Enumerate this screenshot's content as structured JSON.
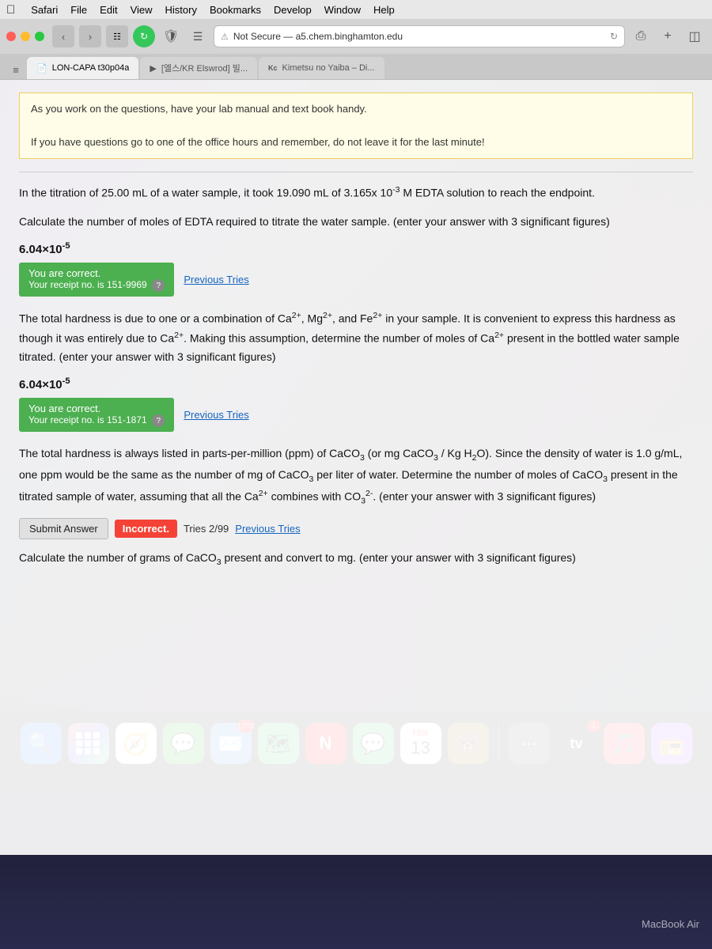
{
  "menubar": {
    "apple": "🍎",
    "items": [
      "Safari",
      "File",
      "Edit",
      "View",
      "History",
      "Bookmarks",
      "Develop",
      "Window",
      "Help"
    ]
  },
  "browser": {
    "url": "Not Secure — a5.chem.binghamton.edu",
    "url_full": "a5.chem.binghamton.edu",
    "tabs": [
      {
        "label": "LON-CAPA t30p04a",
        "icon": "📄",
        "active": true
      },
      {
        "label": "[엘스/KR Elswrod] 빌...",
        "icon": "▶",
        "active": false
      },
      {
        "label": "Kimetsu no Yaiba – Di...",
        "icon": "Kc",
        "active": false
      }
    ]
  },
  "notice": {
    "line1": "As you work on the questions, have your lab manual and text book handy.",
    "line2": "If you have questions go to one of the office hours and remember, do not leave it for the last minute!"
  },
  "question1": {
    "text": "In the titration of 25.00 mL of a water sample, it took 19.090 mL of 3.165x 10⁻³ M EDTA solution to reach the endpoint.",
    "subtext": "Calculate the number of moles of EDTA required to titrate the water sample. (enter your answer with 3 significant figures)",
    "answer": "6.04×10⁻⁵",
    "status": "You are correct.",
    "receipt": "Your receipt no. is 151-9969",
    "prev_tries": "Previous Tries"
  },
  "question2": {
    "text": "The total hardness is due to one or a combination of Ca²⁺, Mg²⁺, and Fe²⁺ in your sample. It is convenient to express this hardness as though it was entirely due to Ca²⁺. Making this assumption, determine the number of moles of Ca²⁺ present in the bottled water sample titrated. (enter your answer with 3 significant figures)",
    "answer": "6.04×10⁻⁵",
    "status": "You are correct.",
    "receipt": "Your receipt no. is 151-1871",
    "prev_tries": "Previous Tries"
  },
  "question3": {
    "text1": "The total hardness is always listed in parts-per-million (ppm) of CaCO₃ (or mg CaCO₃ / Kg H₂O). Since the density of water is 1.0 g/mL, one ppm would be the same as the number of mg of CaCO₃ per liter of water. Determine the number of moles of CaCO₃ present in the titrated sample of water, assuming that all the Ca²⁺ combines with CO₃²⁻. (enter your answer with 3 significant figures)",
    "submit_label": "Submit Answer",
    "status": "Incorrect.",
    "tries": "Tries 2/99",
    "prev_tries": "Previous Tries"
  },
  "question4": {
    "text": "Calculate the number of grams of CaCO₃ present and convert to mg. (enter your answer with 3 significant figures)"
  },
  "dock": {
    "icons": [
      {
        "emoji": "🔍",
        "label": "Finder",
        "bg": "#1a73e8"
      },
      {
        "emoji": "⠿",
        "label": "Launchpad",
        "bg": "#e0e0e0"
      },
      {
        "emoji": "🧭",
        "label": "Safari",
        "bg": "#34c759"
      },
      {
        "emoji": "💬",
        "label": "WeChat",
        "bg": "#2db526"
      },
      {
        "emoji": "📧",
        "label": "Mail",
        "bg": "#e8f0fe",
        "badge": "1772"
      },
      {
        "emoji": "🗺",
        "label": "Maps",
        "bg": "#34c759"
      },
      {
        "emoji": "N",
        "label": "News",
        "bg": "#f00"
      },
      {
        "emoji": "📱",
        "label": "Messages",
        "bg": "#34c759"
      },
      {
        "feb": true,
        "month": "FEB",
        "day": "13",
        "label": "Calendar"
      },
      {
        "emoji": "🟤",
        "label": "Bear",
        "bg": "#b5651d"
      },
      {
        "emoji": "⠿",
        "label": "App",
        "bg": "#888"
      },
      {
        "emoji": "📺",
        "label": "Apple TV",
        "bg": "#1a1a1a",
        "badge": "1"
      },
      {
        "emoji": "🎵",
        "label": "Music",
        "bg": "#fc3c44"
      },
      {
        "emoji": "📻",
        "label": "Podcasts",
        "bg": "#a855f7"
      }
    ]
  },
  "desktop": {
    "macbook_label": "MacBook Air"
  }
}
